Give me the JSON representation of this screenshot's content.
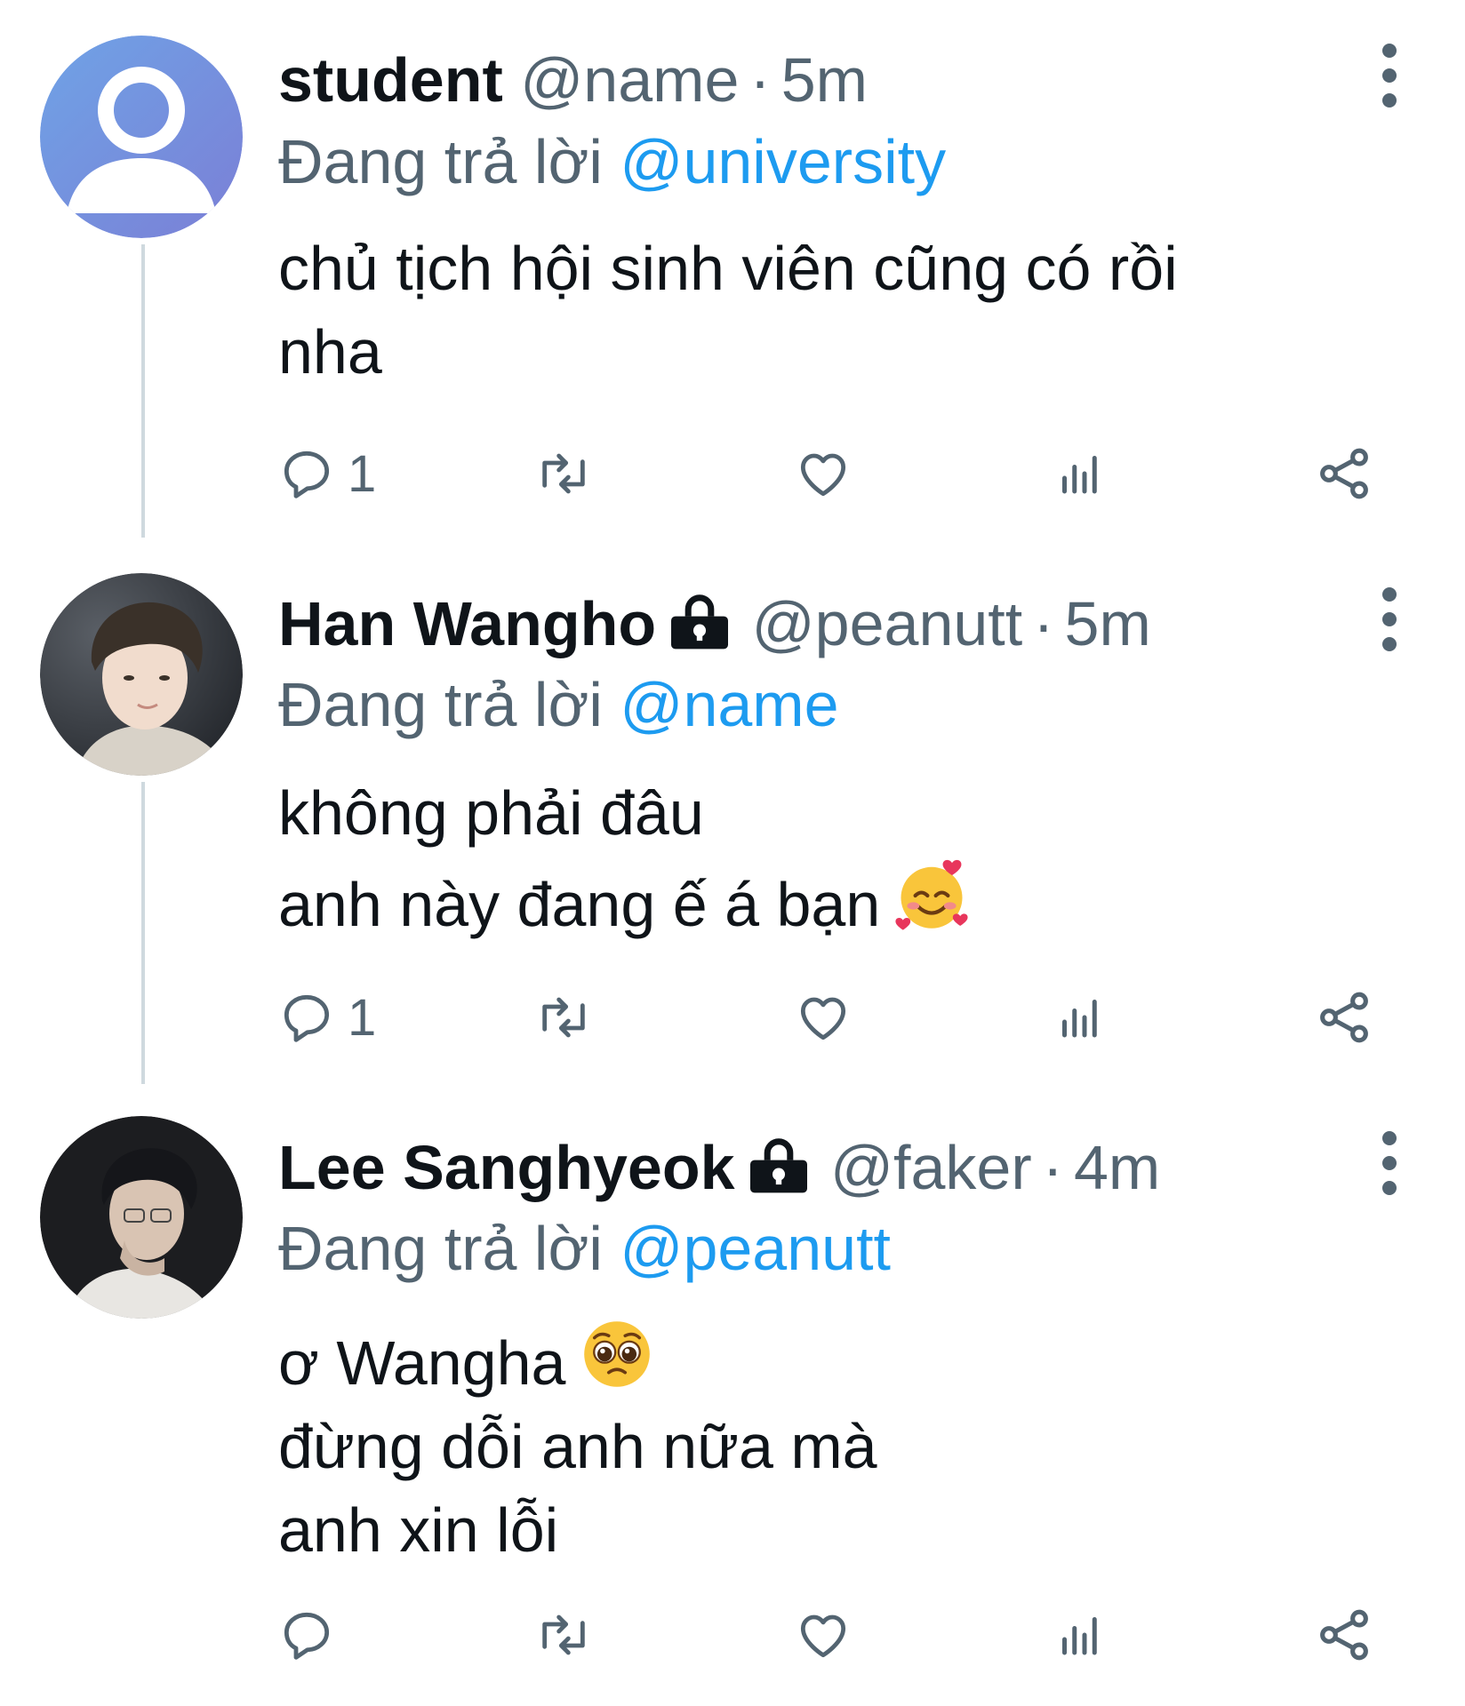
{
  "tweets": [
    {
      "display_name": "student",
      "verified_lock": false,
      "handle": "@name",
      "separator": "·",
      "time": "5m",
      "reply_prefix": "Đang trả lời",
      "reply_to": "@university",
      "text_lines": [
        "chủ tịch hội sinh viên cũng có rồi",
        "nha"
      ],
      "reply_count": "1",
      "avatar": "default-user-avatar"
    },
    {
      "display_name": "Han Wangho",
      "verified_lock": true,
      "handle": "@peanutt",
      "separator": "·",
      "time": "5m",
      "reply_prefix": "Đang trả lời",
      "reply_to": "@name",
      "text_lines": [
        "không phải đâu",
        "anh này đang ế á bạn"
      ],
      "emoji": "smiling-face-with-hearts",
      "reply_count": "1",
      "avatar": "photo-avatar"
    },
    {
      "display_name": "Lee Sanghyeok",
      "verified_lock": true,
      "handle": "@faker",
      "separator": "·",
      "time": "4m",
      "reply_prefix": "Đang trả lời",
      "reply_to": "@peanutt",
      "text_lines": [
        "ơ Wangha",
        "đừng dỗi anh nữa mà",
        "anh xin lỗi"
      ],
      "emoji": "pleading-face",
      "reply_count": "",
      "avatar": "photo-avatar"
    }
  ],
  "colors": {
    "text_primary": "#0f1419",
    "text_secondary": "#536471",
    "mention": "#1d9bf0",
    "thread_line": "#cfd9de"
  },
  "icons": [
    "reply-icon",
    "retweet-icon",
    "like-icon",
    "views-icon",
    "share-icon",
    "more-icon",
    "lock-icon"
  ]
}
